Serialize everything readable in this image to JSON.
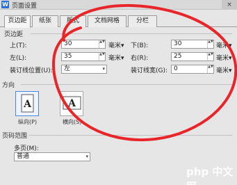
{
  "window": {
    "title": "页面设置",
    "app_icon_letter": "W",
    "close_label": "×"
  },
  "tabs": [
    {
      "label": "页边距",
      "active": true
    },
    {
      "label": "纸张",
      "active": false
    },
    {
      "label": "版式",
      "active": false
    },
    {
      "label": "文档网格",
      "active": false
    },
    {
      "label": "分栏",
      "active": false
    }
  ],
  "margins": {
    "section_label": "页边距",
    "top": {
      "label": "上(T):",
      "value": "30",
      "unit": "毫米▾"
    },
    "bottom": {
      "label": "下(B):",
      "value": "30",
      "unit": "毫米▾"
    },
    "left": {
      "label": "左(L):",
      "value": "35",
      "unit": "毫米▾"
    },
    "right": {
      "label": "右(R):",
      "value": "25",
      "unit": "毫米▾"
    },
    "gutter_position": {
      "label": "装订线位置(U):",
      "value": "左"
    },
    "gutter": {
      "label": "装订线宽(G):",
      "value": "0",
      "unit": "毫米▾"
    }
  },
  "orientation": {
    "section_label": "方向",
    "portrait_label": "纵向(P)",
    "landscape_label": "横向(S)",
    "icon_letter": "A"
  },
  "page_range": {
    "section_label": "页码范围",
    "multi_label": "多页(M):",
    "multi_value": "普通"
  },
  "watermark": "php 中文网",
  "spin_arrows": "▲▼",
  "dropdown_arrow": "▾",
  "colors": {
    "annotation_red": "#e8262a",
    "selection_blue": "#4a86d9"
  }
}
